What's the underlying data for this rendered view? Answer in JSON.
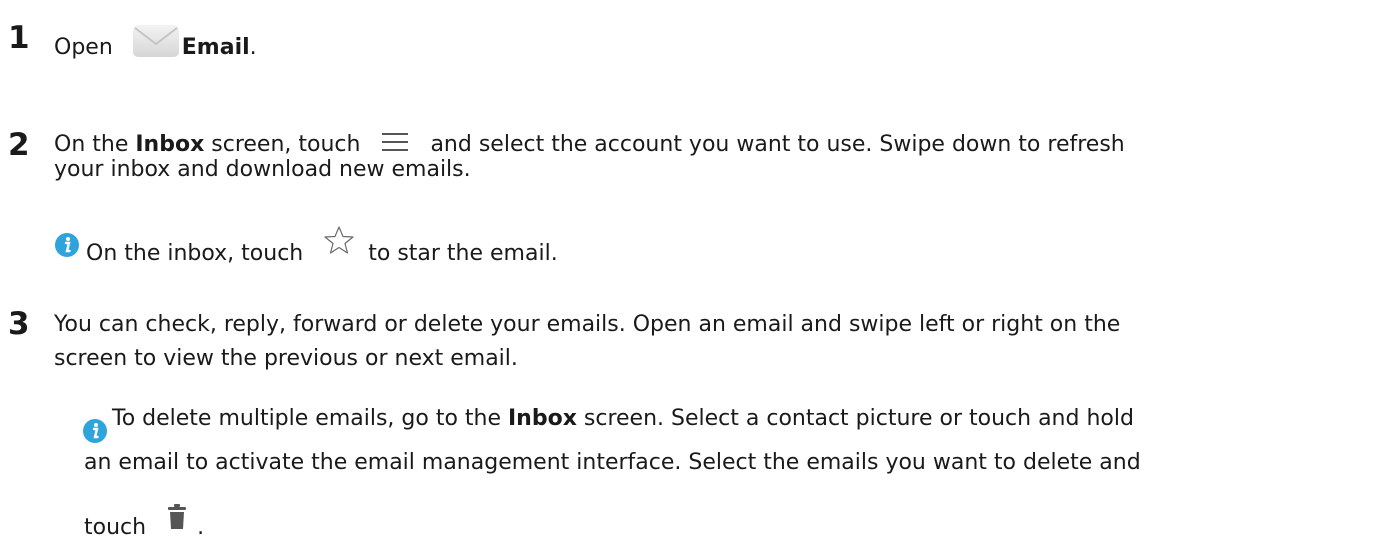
{
  "step1": {
    "number": "1",
    "text_before": "Open",
    "app_name": "Email",
    "text_after": ".",
    "icon": "email-app-icon"
  },
  "step2": {
    "number": "2",
    "line1_a": "On the ",
    "line1_bold": "Inbox",
    "line1_b": " screen, touch",
    "line1_c": "and select the account you want to use. Swipe down to refresh",
    "line2": "your inbox and download new emails.",
    "menu_icon": "menu-icon",
    "tip": {
      "icon": "info-icon",
      "text_a": "On the inbox, touch",
      "star_icon": "star-outline-icon",
      "text_b": "to star the email."
    }
  },
  "step3": {
    "number": "3",
    "line1": "You can check, reply, forward or delete your emails. Open an email and swipe left or right on the",
    "line2": "screen to view the previous or next email.",
    "note": {
      "icon": "info-icon",
      "line1_a": "To delete multiple emails, go to the ",
      "line1_bold": "Inbox",
      "line1_b": " screen. Select a contact picture or touch and hold",
      "line2": "an email to activate the email management interface. Select the emails you want to delete and",
      "line3_a": "touch",
      "trash_icon": "trash-icon",
      "line3_b": "."
    }
  },
  "colors": {
    "text": "#1a1a1a",
    "info_blue": "#2fa4dc",
    "icon_gray": "#555555"
  }
}
